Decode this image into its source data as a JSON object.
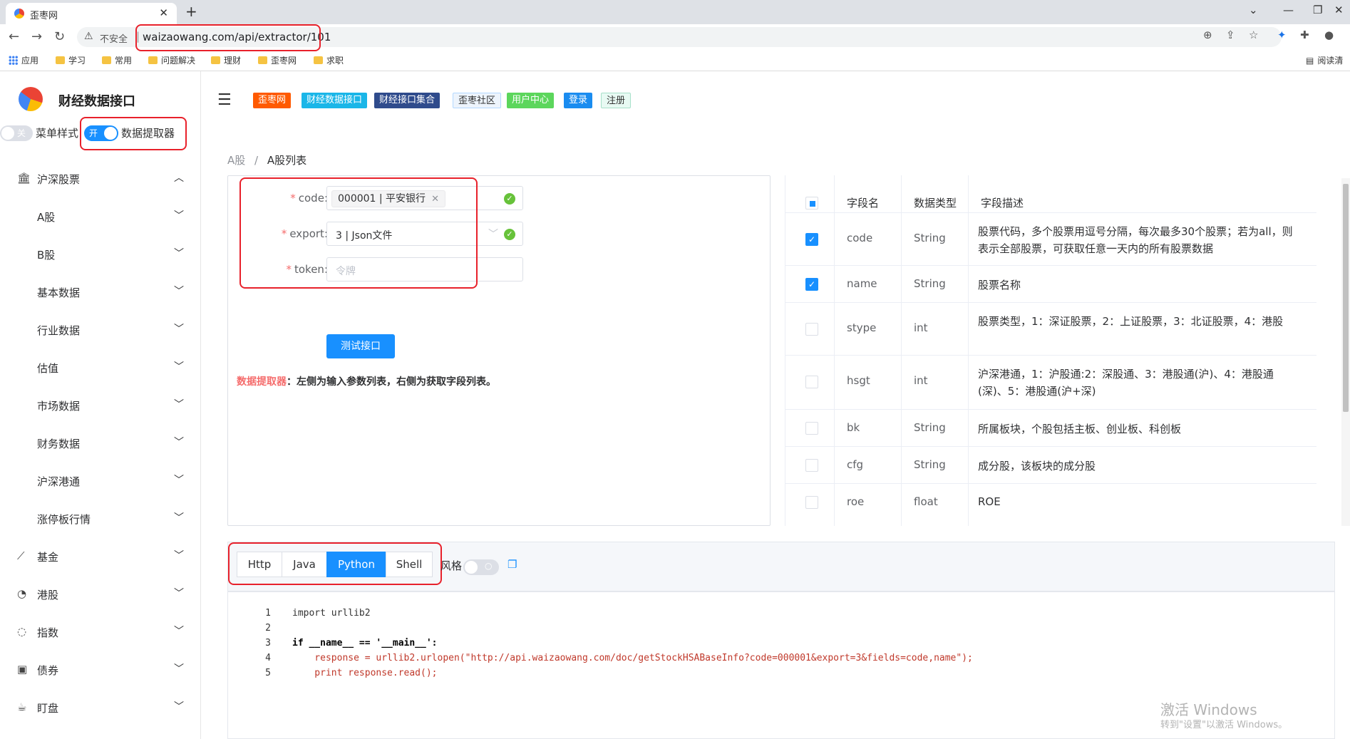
{
  "browser": {
    "tab_title": "歪枣网",
    "insecure_label": "不安全",
    "url": "waizaowang.com/api/extractor/101",
    "bookmarks": [
      "应用",
      "学习",
      "常用",
      "问题解决",
      "理财",
      "歪枣网",
      "求职"
    ],
    "reading_list": "阅读清"
  },
  "sidebar": {
    "brand": "财经数据接口",
    "menu_style_switch": {
      "state_text": "关",
      "label": "菜单样式"
    },
    "extractor_switch": {
      "state_text": "开",
      "label": "数据提取器"
    },
    "items": [
      {
        "label": "沪深股票",
        "icon": "bank-icon",
        "expanded": true
      },
      {
        "label": "A股",
        "sub": true
      },
      {
        "label": "B股",
        "sub": true
      },
      {
        "label": "基本数据",
        "sub": true
      },
      {
        "label": "行业数据",
        "sub": true
      },
      {
        "label": "估值",
        "sub": true
      },
      {
        "label": "市场数据",
        "sub": true
      },
      {
        "label": "财务数据",
        "sub": true
      },
      {
        "label": "沪深港通",
        "sub": true
      },
      {
        "label": "涨停板行情",
        "sub": true
      },
      {
        "label": "基金",
        "icon": "chart-icon"
      },
      {
        "label": "港股",
        "icon": "bell-icon"
      },
      {
        "label": "指数",
        "icon": "bulb-icon"
      },
      {
        "label": "债券",
        "icon": "box-icon"
      },
      {
        "label": "盯盘",
        "icon": "cup-icon"
      }
    ]
  },
  "header": {
    "tags": [
      {
        "label": "歪枣网",
        "color": "#ff5a00"
      },
      {
        "label": "财经数据接口",
        "color": "#1ab6e8"
      },
      {
        "label": "财经接口集合",
        "color": "#2f4b8c"
      },
      {
        "label": "歪枣社区",
        "color": "#edf4fc"
      },
      {
        "label": "用户中心",
        "color": "#5cd65c"
      },
      {
        "label": "登录",
        "color": "#1a8cf0"
      },
      {
        "label": "注册",
        "color": "#e8faf3"
      }
    ]
  },
  "breadcrumb": {
    "parent": "A股",
    "separator": "/",
    "current": "A股列表"
  },
  "form": {
    "code_label": "code",
    "code_value": "000001 | 平安银行",
    "export_label": "export",
    "export_value": "3 | Json文件",
    "token_label": "token",
    "token_placeholder": "令牌",
    "test_button": "测试接口",
    "note_title": "数据提取器",
    "note_text": "：左侧为输入参数列表，右侧为获取字段列表。"
  },
  "fields_table": {
    "headers": [
      "字段名",
      "数据类型",
      "字段描述"
    ],
    "rows": [
      {
        "name": "code",
        "type": "String",
        "desc": "股票代码，多个股票用逗号分隔，每次最多30个股票；若为all，则表示全部股票，可获取任意一天内的所有股票数据",
        "checked": true
      },
      {
        "name": "name",
        "type": "String",
        "desc": "股票名称",
        "checked": true
      },
      {
        "name": "stype",
        "type": "int",
        "desc": "股票类型，1：深证股票，2：上证股票，3：北证股票，4：港股",
        "checked": false
      },
      {
        "name": "hsgt",
        "type": "int",
        "desc": "沪深港通，1：沪股通:2：深股通、3：港股通(沪)、4：港股通(深)、5：港股通(沪+深)",
        "checked": false
      },
      {
        "name": "bk",
        "type": "String",
        "desc": "所属板块，个股包括主板、创业板、科创板",
        "checked": false
      },
      {
        "name": "cfg",
        "type": "String",
        "desc": "成分股，该板块的成分股",
        "checked": false
      },
      {
        "name": "roe",
        "type": "float",
        "desc": "ROE",
        "checked": false
      }
    ]
  },
  "code_tabs": {
    "tabs": [
      "Http",
      "Java",
      "Python",
      "Shell"
    ],
    "active": "Python",
    "style_label": "风格"
  },
  "code": {
    "lines": [
      "import urllib2",
      "",
      "if __name__ == '__main__':",
      "    response = urllib2.urlopen(\"http://api.waizaowang.com/doc/getStockHSABaseInfo?code=000001&export=3&fields=code,name\");",
      "    print response.read();"
    ]
  },
  "watermark": {
    "title": "激活 Windows",
    "subtitle": "转到\"设置\"以激活 Windows。"
  }
}
